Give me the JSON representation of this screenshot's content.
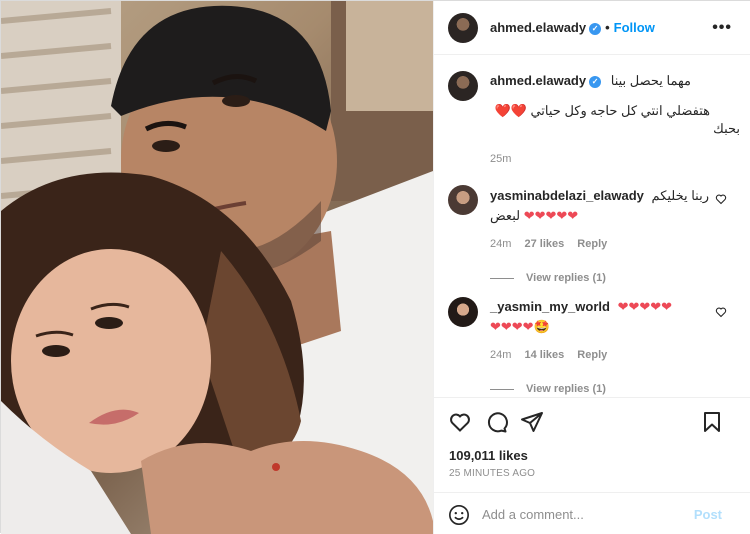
{
  "post": {
    "author": "ahmed.elawady",
    "follow_label": "Follow",
    "more_label": "•••",
    "separator": "•"
  },
  "caption": {
    "author": "ahmed.elawady",
    "line1": "مهما يحصل بينا",
    "line2_text": "هتفضلي انتي كل حاجه وكل حياتي",
    "line2_hearts": "❤️❤️",
    "line3": "بحبك",
    "time": "25m"
  },
  "comments": [
    {
      "username": "yasminabdelazi_elawady",
      "text": "ربنا يخليكم",
      "text2": "لبعض",
      "hearts2": "❤❤❤❤❤",
      "time": "24m",
      "likes": "27 likes",
      "reply_label": "Reply",
      "view_replies": "View replies (1)"
    },
    {
      "username": "_yasmin_my_world",
      "hearts1": "❤❤❤❤❤",
      "hearts2": "❤❤❤❤",
      "emoji": "🤩",
      "time": "24m",
      "likes": "14 likes",
      "reply_label": "Reply",
      "view_replies": "View replies (1)"
    }
  ],
  "stats": {
    "likes": "109,011 likes",
    "time_ago": "25 MINUTES AGO"
  },
  "comment_box": {
    "placeholder": "Add a comment...",
    "post_label": "Post"
  },
  "icons": {
    "heart": "heart-icon",
    "comment": "comment-icon",
    "share": "share-icon",
    "save": "bookmark-icon",
    "emoji": "emoji-icon",
    "verified": "verified-badge-icon"
  },
  "colors": {
    "accent": "#0095f6",
    "heart": "#ed4956",
    "muted": "#8e8e8e",
    "border": "#efefef",
    "post_disabled": "#b2dffc"
  }
}
